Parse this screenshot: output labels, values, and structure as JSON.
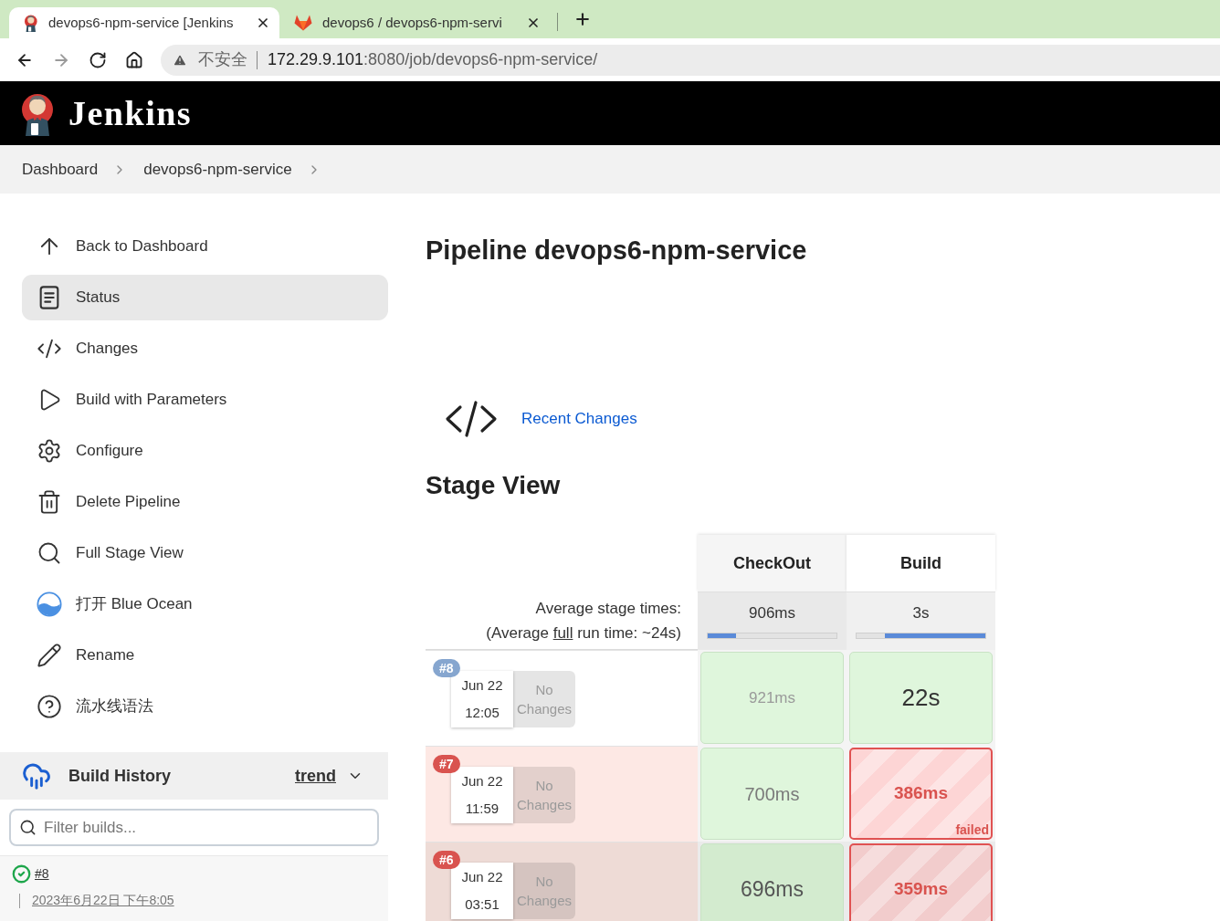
{
  "browser": {
    "tabs": [
      {
        "title": "devops6-npm-service [Jenkins",
        "selected": true
      },
      {
        "title": "devops6 / devops6-npm-servi",
        "selected": false
      }
    ],
    "nav_buttons": [
      {
        "disabled": false
      },
      {
        "disabled": true
      },
      {
        "disabled": false
      },
      {
        "disabled": false
      }
    ],
    "address": {
      "security": "不安全",
      "host": "172.29.9.101",
      "path": ":8080/job/devops6-npm-service/"
    }
  },
  "header": {
    "title": "Jenkins"
  },
  "breadcrumbs": [
    "Dashboard",
    "devops6-npm-service"
  ],
  "sidebar": {
    "items": [
      {
        "label": "Back to Dashboard",
        "selected": false
      },
      {
        "label": "Status",
        "selected": true
      },
      {
        "label": "Changes",
        "selected": false
      },
      {
        "label": "Build with Parameters",
        "selected": false
      },
      {
        "label": "Configure",
        "selected": false
      },
      {
        "label": "Delete Pipeline",
        "selected": false
      },
      {
        "label": "Full Stage View",
        "selected": false
      },
      {
        "label": "打开 Blue Ocean",
        "selected": false
      },
      {
        "label": "Rename",
        "selected": false
      },
      {
        "label": "流水线语法",
        "selected": false
      }
    ],
    "build_history": {
      "title": "Build History",
      "trend": "trend",
      "filter": {
        "placeholder": "Filter builds..."
      },
      "builds": [
        {
          "number": "#8",
          "success": true,
          "date": "2023年6月22日 下午8:05"
        }
      ]
    }
  },
  "main": {
    "title": "Pipeline devops6-npm-service",
    "recent_changes": "Recent Changes",
    "stage_view": {
      "title": "Stage View",
      "average_label": "Average stage times:",
      "average_run": {
        "before": "(Average",
        "link": "full",
        "after": "run time: ~24s)"
      },
      "stages": [
        {
          "name": "CheckOut",
          "average": "906ms",
          "level": 0.22
        },
        {
          "name": "Build",
          "average": "3s",
          "level": 0.78
        }
      ],
      "runs": [
        {
          "number": "#8",
          "failed": false,
          "hovered": false,
          "date": "Jun 22",
          "time": "12:05",
          "changes": "No Changes",
          "cells": [
            {
              "duration": "921ms",
              "kind": "faint"
            },
            {
              "duration": "22s",
              "kind": "strong"
            }
          ]
        },
        {
          "number": "#7",
          "failed": true,
          "hovered": false,
          "date": "Jun 22",
          "time": "11:59",
          "changes": "No Changes",
          "cells": [
            {
              "duration": "700ms",
              "kind": "muted"
            },
            {
              "duration": "386ms",
              "kind": "failed",
              "label": "failed"
            }
          ]
        },
        {
          "number": "#6",
          "failed": true,
          "hovered": true,
          "date": "Jun 22",
          "time": "03:51",
          "changes": "No Changes",
          "cells": [
            {
              "duration": "696ms",
              "kind": "dark"
            },
            {
              "duration": "359ms",
              "kind": "failed"
            }
          ]
        }
      ]
    }
  }
}
